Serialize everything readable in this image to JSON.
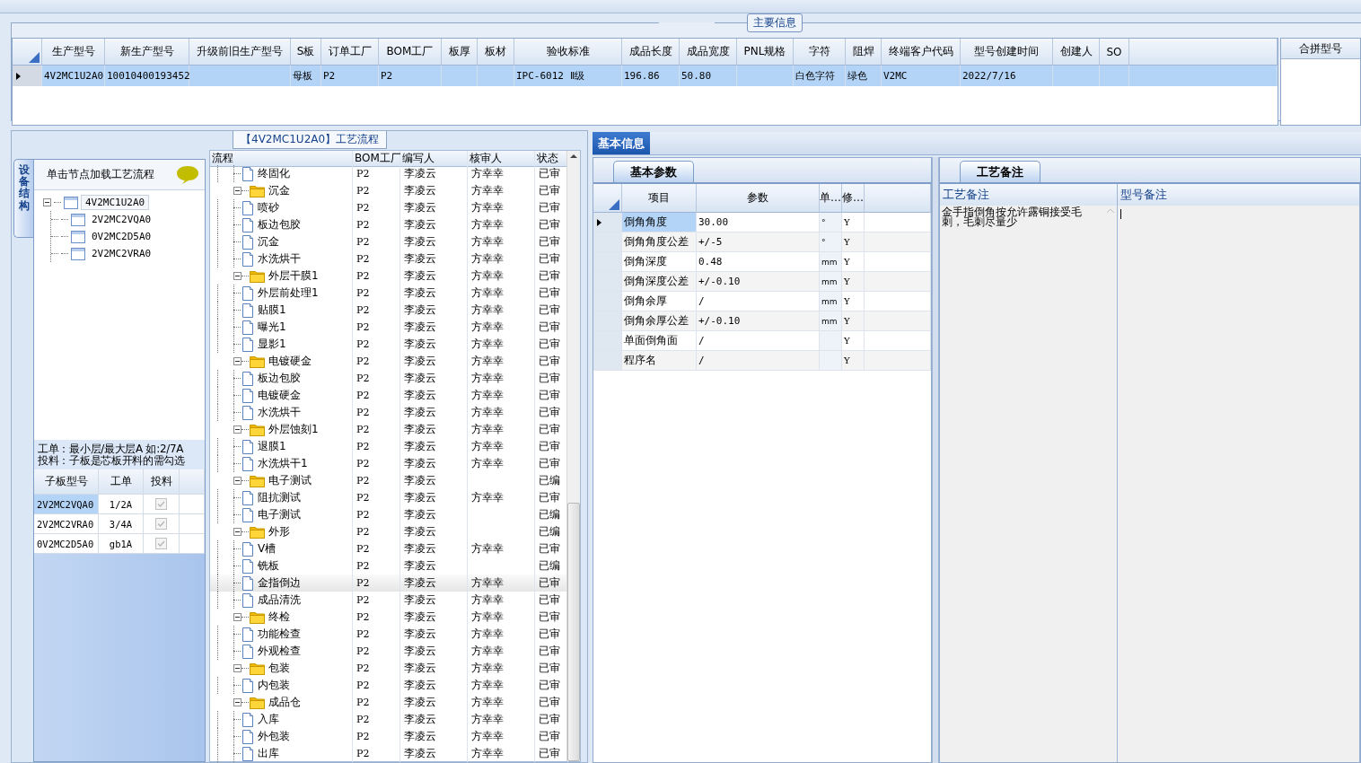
{
  "main_info": {
    "title": "主要信息",
    "columns": [
      "生产型号",
      "新生产型号",
      "升级前旧生产型号",
      "S板",
      "订单工厂",
      "BOM工厂",
      "板厚",
      "板材",
      "验收标准",
      "成品长度",
      "成品宽度",
      "PNL规格",
      "字符",
      "阻焊",
      "终端客户代码",
      "型号创建时间",
      "创建人",
      "SO"
    ],
    "rows": [
      {
        "selected": true,
        "cells": [
          "4V2MC1U2A0",
          "10010400193452",
          null,
          "母板",
          "P2",
          "P2",
          null,
          null,
          "IPC-6012 Ⅱ级",
          "196.86",
          "50.80",
          null,
          "白色字符",
          "绿色",
          "V2MC",
          "2022/7/16",
          null,
          null
        ]
      }
    ]
  },
  "merge_panel": {
    "header": "合拼型号"
  },
  "left": {
    "side_tab": "设备结构",
    "hint": "单击节点加载工艺流程",
    "tree": [
      {
        "label": "4V2MC1U2A0",
        "expanded": true,
        "selected": true,
        "children": [
          {
            "label": "2V2MC2VQA0",
            "selected": false
          },
          {
            "label": "0V2MC2D5A0",
            "selected": false
          },
          {
            "label": "2V2MC2VRA0",
            "selected": false
          }
        ]
      }
    ],
    "notes": [
      "工单：最小层/最大层A 如:2/7A",
      "投料：子板是芯板开料的需勾选"
    ],
    "sub_boards": {
      "columns": [
        "子板型号",
        "工单",
        "投料"
      ],
      "rows": [
        {
          "selected": true,
          "board": "2V2MC2VQA0",
          "order": "1/2A",
          "checked": true,
          "disabled": true
        },
        {
          "selected": false,
          "board": "2V2MC2VRA0",
          "order": "3/4A",
          "checked": true,
          "disabled": true
        },
        {
          "selected": false,
          "board": "0V2MC2D5A0",
          "order": "gb1A",
          "checked": true,
          "disabled": true
        }
      ]
    }
  },
  "process": {
    "title": "【4V2MC1U2A0】工艺流程",
    "columns": [
      "流程",
      "BOM工厂",
      "编写人",
      "核审人",
      "状态"
    ],
    "continued": [
      {
        "name": "终固化",
        "bom": "P2",
        "writer": "李凌云",
        "reviewer": "方幸幸",
        "status": "已审",
        "selected": false
      }
    ],
    "groups": [
      {
        "name": "沉金",
        "bom": "P2",
        "writer": "李凌云",
        "reviewer": "方幸幸",
        "status": "已审",
        "expanded": true,
        "selected": false,
        "children": [
          {
            "name": "喷砂",
            "bom": "P2",
            "writer": "李凌云",
            "reviewer": "方幸幸",
            "status": "已审",
            "selected": false
          },
          {
            "name": "板边包胶",
            "bom": "P2",
            "writer": "李凌云",
            "reviewer": "方幸幸",
            "status": "已审",
            "selected": false
          },
          {
            "name": "沉金",
            "bom": "P2",
            "writer": "李凌云",
            "reviewer": "方幸幸",
            "status": "已审",
            "selected": false
          },
          {
            "name": "水洗烘干",
            "bom": "P2",
            "writer": "李凌云",
            "reviewer": "方幸幸",
            "status": "已审",
            "selected": false
          }
        ]
      },
      {
        "name": "外层干膜1",
        "bom": "P2",
        "writer": "李凌云",
        "reviewer": "方幸幸",
        "status": "已审",
        "expanded": true,
        "selected": false,
        "children": [
          {
            "name": "外层前处理1",
            "bom": "P2",
            "writer": "李凌云",
            "reviewer": "方幸幸",
            "status": "已审",
            "selected": false
          },
          {
            "name": "贴膜1",
            "bom": "P2",
            "writer": "李凌云",
            "reviewer": "方幸幸",
            "status": "已审",
            "selected": false
          },
          {
            "name": "曝光1",
            "bom": "P2",
            "writer": "李凌云",
            "reviewer": "方幸幸",
            "status": "已审",
            "selected": false
          },
          {
            "name": "显影1",
            "bom": "P2",
            "writer": "李凌云",
            "reviewer": "方幸幸",
            "status": "已审",
            "selected": false
          }
        ]
      },
      {
        "name": "电镀硬金",
        "bom": "P2",
        "writer": "李凌云",
        "reviewer": "方幸幸",
        "status": "已审",
        "expanded": true,
        "selected": false,
        "children": [
          {
            "name": "板边包胶",
            "bom": "P2",
            "writer": "李凌云",
            "reviewer": "方幸幸",
            "status": "已审",
            "selected": false
          },
          {
            "name": "电镀硬金",
            "bom": "P2",
            "writer": "李凌云",
            "reviewer": "方幸幸",
            "status": "已审",
            "selected": false
          },
          {
            "name": "水洗烘干",
            "bom": "P2",
            "writer": "李凌云",
            "reviewer": "方幸幸",
            "status": "已审",
            "selected": false
          }
        ]
      },
      {
        "name": "外层蚀刻1",
        "bom": "P2",
        "writer": "李凌云",
        "reviewer": "方幸幸",
        "status": "已审",
        "expanded": true,
        "selected": false,
        "children": [
          {
            "name": "退膜1",
            "bom": "P2",
            "writer": "李凌云",
            "reviewer": "方幸幸",
            "status": "已审",
            "selected": false
          },
          {
            "name": "水洗烘干1",
            "bom": "P2",
            "writer": "李凌云",
            "reviewer": "方幸幸",
            "status": "已审",
            "selected": false
          }
        ]
      },
      {
        "name": "电子测试",
        "bom": "P2",
        "writer": "李凌云",
        "status": "已编",
        "expanded": true,
        "selected": false,
        "children": [
          {
            "name": "阻抗测试",
            "bom": "P2",
            "writer": "李凌云",
            "reviewer": "方幸幸",
            "status": "已审",
            "selected": false
          },
          {
            "name": "电子测试",
            "bom": "P2",
            "writer": "李凌云",
            "status": "已编",
            "selected": false
          }
        ]
      },
      {
        "name": "外形",
        "bom": "P2",
        "writer": "李凌云",
        "status": "已编",
        "expanded": true,
        "selected": false,
        "children": [
          {
            "name": "V槽",
            "bom": "P2",
            "writer": "李凌云",
            "reviewer": "方幸幸",
            "status": "已审",
            "selected": false
          },
          {
            "name": "铣板",
            "bom": "P2",
            "writer": "李凌云",
            "status": "已编",
            "selected": false
          },
          {
            "name": "金指倒边",
            "bom": "P2",
            "writer": "李凌云",
            "reviewer": "方幸幸",
            "status": "已审",
            "selected": true
          },
          {
            "name": "成品清洗",
            "bom": "P2",
            "writer": "李凌云",
            "reviewer": "方幸幸",
            "status": "已审",
            "selected": false
          }
        ]
      },
      {
        "name": "终检",
        "bom": "P2",
        "writer": "李凌云",
        "reviewer": "方幸幸",
        "status": "已审",
        "expanded": true,
        "selected": false,
        "children": [
          {
            "name": "功能检查",
            "bom": "P2",
            "writer": "李凌云",
            "reviewer": "方幸幸",
            "status": "已审",
            "selected": false
          },
          {
            "name": "外观检查",
            "bom": "P2",
            "writer": "李凌云",
            "reviewer": "方幸幸",
            "status": "已审",
            "selected": false
          }
        ]
      },
      {
        "name": "包装",
        "bom": "P2",
        "writer": "李凌云",
        "reviewer": "方幸幸",
        "status": "已审",
        "expanded": true,
        "selected": false,
        "children": [
          {
            "name": "内包装",
            "bom": "P2",
            "writer": "李凌云",
            "reviewer": "方幸幸",
            "status": "已审",
            "selected": false
          }
        ]
      },
      {
        "name": "成品仓",
        "bom": "P2",
        "writer": "李凌云",
        "reviewer": "方幸幸",
        "status": "已审",
        "expanded": true,
        "selected": false,
        "children": [
          {
            "name": "入库",
            "bom": "P2",
            "writer": "李凌云",
            "reviewer": "方幸幸",
            "status": "已审",
            "selected": false
          },
          {
            "name": "外包装",
            "bom": "P2",
            "writer": "李凌云",
            "reviewer": "方幸幸",
            "status": "已审",
            "selected": false
          },
          {
            "name": "出库",
            "bom": "P2",
            "writer": "李凌云",
            "reviewer": "方幸幸",
            "status": "已审",
            "selected": false
          }
        ]
      }
    ]
  },
  "detail_tabs": [
    {
      "label": "基本信息",
      "selected": true
    }
  ],
  "params": {
    "tab": {
      "label": "基本参数",
      "selected": true
    },
    "columns": [
      "项目",
      "参数",
      "单…",
      "修…"
    ],
    "rows": [
      {
        "selected": true,
        "item": "倒角角度",
        "value": "30.00",
        "unit": "°",
        "flag": "Y"
      },
      {
        "selected": false,
        "item": "倒角角度公差",
        "value": "+/-5",
        "unit": "°",
        "flag": "Y"
      },
      {
        "selected": false,
        "item": "倒角深度",
        "value": "0.48",
        "unit": "mm",
        "flag": "Y"
      },
      {
        "selected": false,
        "item": "倒角深度公差",
        "value": "+/-0.10",
        "unit": "mm",
        "flag": "Y"
      },
      {
        "selected": false,
        "item": "倒角余厚",
        "value": "/",
        "unit": "mm",
        "flag": "Y"
      },
      {
        "selected": false,
        "item": "倒角余厚公差",
        "value": "+/-0.10",
        "unit": "mm",
        "flag": "Y"
      },
      {
        "selected": false,
        "item": "单面倒角面",
        "value": "/",
        "flag": "Y"
      },
      {
        "selected": false,
        "item": "程序名",
        "value": "/",
        "flag": "Y"
      }
    ]
  },
  "remarks": {
    "tab": {
      "label": "工艺备注",
      "selected": true
    },
    "columns": [
      "工艺备注",
      "型号备注"
    ],
    "text": "金手指倒角按允许露铜接受毛刺，毛刺尽量少"
  }
}
